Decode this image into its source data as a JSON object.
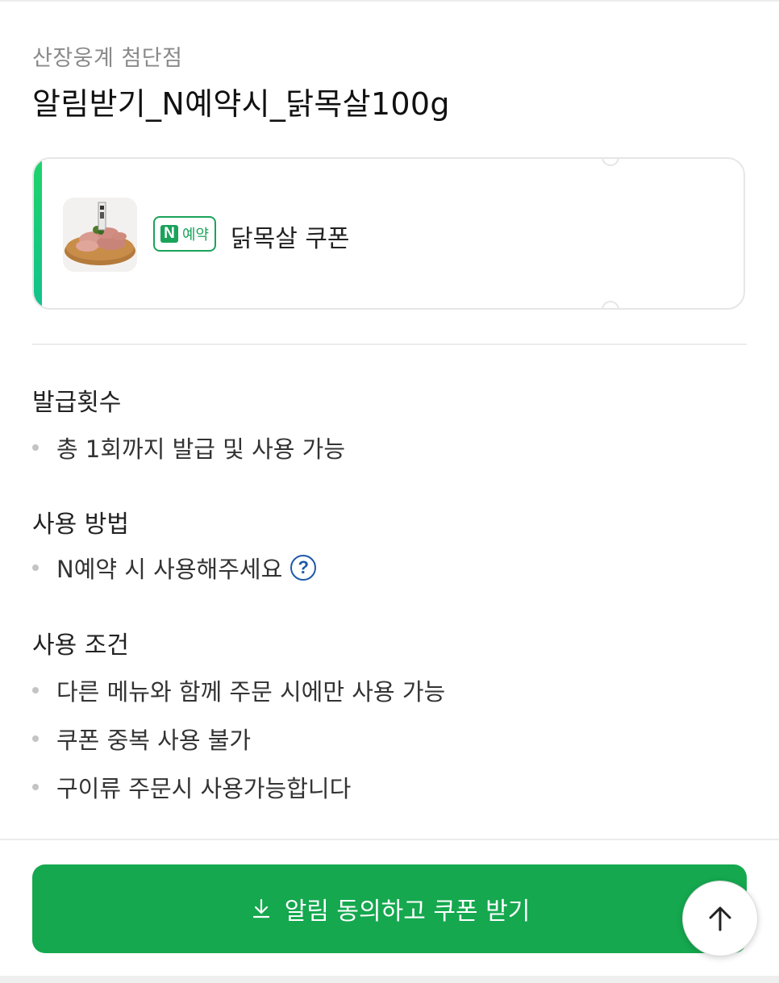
{
  "store": {
    "name": "산장웅계 첨단점"
  },
  "coupon": {
    "title": "알림받기_N예약시_닭목살100g",
    "badge_label": "예약",
    "name": "닭목살 쿠폰"
  },
  "sections": {
    "issue": {
      "heading": "발급횟수",
      "items": [
        "총 1회까지 발급 및 사용 가능"
      ]
    },
    "usage": {
      "heading": "사용 방법",
      "items": [
        "N예약 시 사용해주세요"
      ]
    },
    "conditions": {
      "heading": "사용 조건",
      "items": [
        "다른 메뉴와 함께 주문 시에만 사용 가능",
        "쿠폰 중복 사용 불가",
        "구이류 주문시 사용가능합니다"
      ]
    }
  },
  "cta": {
    "label": "알림 동의하고 쿠폰 받기"
  },
  "icons": {
    "help": "help-icon",
    "download": "download-icon",
    "scroll_top": "arrow-up-icon",
    "badge_logo": "naver-n-icon"
  },
  "colors": {
    "accent_green": "#15a84f",
    "badge_green": "#1aa35a",
    "help_blue": "#1e5aa8"
  }
}
